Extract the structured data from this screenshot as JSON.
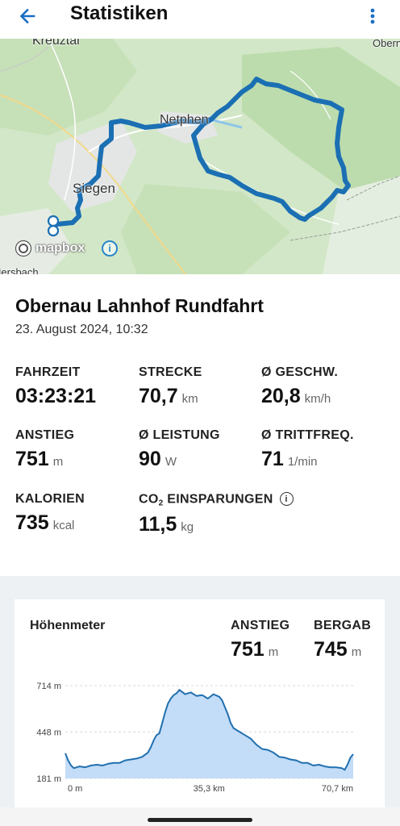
{
  "appbar": {
    "title": "Statistiken",
    "back_icon": "arrow-left-icon",
    "menu_icon": "more-vertical-icon"
  },
  "map": {
    "labels": {
      "kreuztal": "Kreuztal",
      "netphen": "Netphen",
      "siegen": "Siegen",
      "obern": "Obern",
      "hersbach": "Hersbach"
    },
    "attribution": "mapbox",
    "info_icon": "info-icon",
    "route_color": "#1b6fb3"
  },
  "ride": {
    "title": "Obernau Lahnhof Rundfahrt",
    "date": "23. August 2024, 10:32"
  },
  "stats": {
    "fahrzeit": {
      "label": "FAHRZEIT",
      "value": "03:23:21",
      "unit": ""
    },
    "strecke": {
      "label": "STRECKE",
      "value": "70,7",
      "unit": "km"
    },
    "geschw": {
      "label": "Ø GESCHW.",
      "value": "20,8",
      "unit": "km/h"
    },
    "anstieg": {
      "label": "ANSTIEG",
      "value": "751",
      "unit": "m"
    },
    "leistung": {
      "label": "Ø LEISTUNG",
      "value": "90",
      "unit": "W"
    },
    "trittfreq": {
      "label": "Ø TRITTFREQ.",
      "value": "71",
      "unit": "1/min"
    },
    "kalorien": {
      "label": "KALORIEN",
      "value": "735",
      "unit": "kcal"
    },
    "co2": {
      "label_prefix": "CO",
      "label_sub": "2",
      "label_suffix": " EINSPARUNGEN",
      "value": "11,5",
      "unit": "kg",
      "info_icon": "info-icon"
    }
  },
  "elevation": {
    "title": "Höhenmeter",
    "anstieg": {
      "label": "ANSTIEG",
      "value": "751",
      "unit": "m"
    },
    "bergab": {
      "label": "BERGAB",
      "value": "745",
      "unit": "m"
    }
  },
  "chart_data": {
    "type": "area",
    "title": "Höhenmeter",
    "xlabel": "",
    "ylabel": "",
    "y_tick_labels": [
      "714 m",
      "448 m",
      "181 m"
    ],
    "y_ticks": [
      714,
      448,
      181
    ],
    "x_tick_labels": [
      "0 m",
      "35,3 km",
      "70,7 km"
    ],
    "x_ticks": [
      0,
      35.3,
      70.7
    ],
    "xlim": [
      0,
      70.7
    ],
    "ylim": [
      181,
      714
    ],
    "grid": true,
    "color": "#2070b0",
    "fill": "#c3dcf7",
    "series": [
      {
        "x": [
          0,
          0.7,
          1.4,
          2.1,
          2.8,
          3.5,
          4.9,
          6.3,
          7.7,
          9.1,
          10.5,
          11.9,
          13.3,
          14.7,
          16.1,
          17.5,
          18.9,
          20.3,
          21.0,
          21.7,
          22.4,
          23.1,
          23.8,
          24.5,
          25.2,
          25.9,
          26.6,
          27.3,
          28.0,
          29.4,
          30.8,
          32.2,
          33.6,
          35.0,
          36.4,
          37.8,
          38.5,
          39.2,
          39.9,
          40.6,
          41.3,
          42.7,
          44.1,
          45.5,
          46.9,
          48.3,
          49.7,
          51.1,
          52.5,
          53.9,
          55.3,
          56.7,
          58.1,
          59.5,
          60.9,
          62.3,
          63.7,
          65.1,
          66.5,
          67.9,
          68.6,
          69.3,
          70.0,
          70.7
        ],
        "y": [
          325,
          285,
          255,
          240,
          245,
          250,
          245,
          255,
          260,
          255,
          265,
          270,
          270,
          285,
          290,
          295,
          305,
          330,
          360,
          400,
          430,
          440,
          500,
          560,
          610,
          640,
          660,
          670,
          690,
          665,
          675,
          655,
          660,
          640,
          665,
          650,
          630,
          590,
          550,
          500,
          470,
          450,
          430,
          410,
          375,
          350,
          345,
          330,
          305,
          300,
          290,
          285,
          270,
          270,
          255,
          260,
          250,
          245,
          245,
          240,
          230,
          260,
          300,
          320
        ]
      }
    ]
  }
}
